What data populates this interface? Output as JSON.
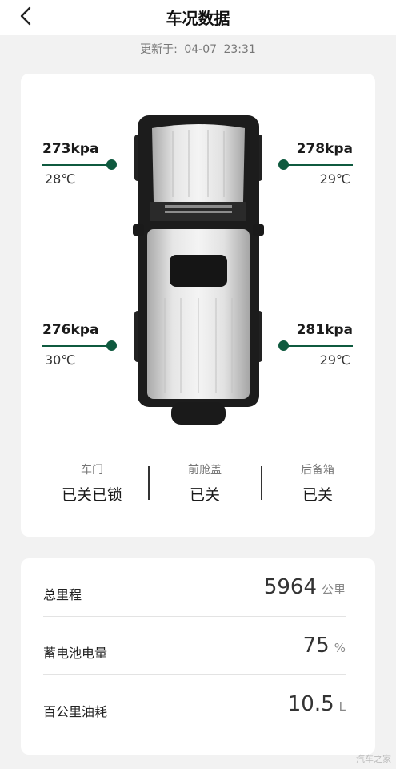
{
  "header": {
    "title": "车况数据",
    "back_icon": "chevron-left-icon"
  },
  "updated": {
    "label": "更新于:",
    "date": "04-07",
    "time": "23:31"
  },
  "tires": {
    "front_left": {
      "pressure": "273kpa",
      "temp": "28℃"
    },
    "front_right": {
      "pressure": "278kpa",
      "temp": "29℃"
    },
    "rear_left": {
      "pressure": "276kpa",
      "temp": "30℃"
    },
    "rear_right": {
      "pressure": "281kpa",
      "temp": "29℃"
    }
  },
  "status": [
    {
      "label": "车门",
      "value": "已关已锁"
    },
    {
      "label": "前舱盖",
      "value": "已关"
    },
    {
      "label": "后备箱",
      "value": "已关"
    }
  ],
  "stats": [
    {
      "label": "总里程",
      "value": "5964",
      "unit": "公里"
    },
    {
      "label": "蓄电池电量",
      "value": "75",
      "unit": "%"
    },
    {
      "label": "百公里油耗",
      "value": "10.5",
      "unit": "L"
    }
  ],
  "colors": {
    "accent": "#0f5a3f",
    "background": "#f2f2f2",
    "card": "#ffffff"
  },
  "watermark": "汽车之家"
}
